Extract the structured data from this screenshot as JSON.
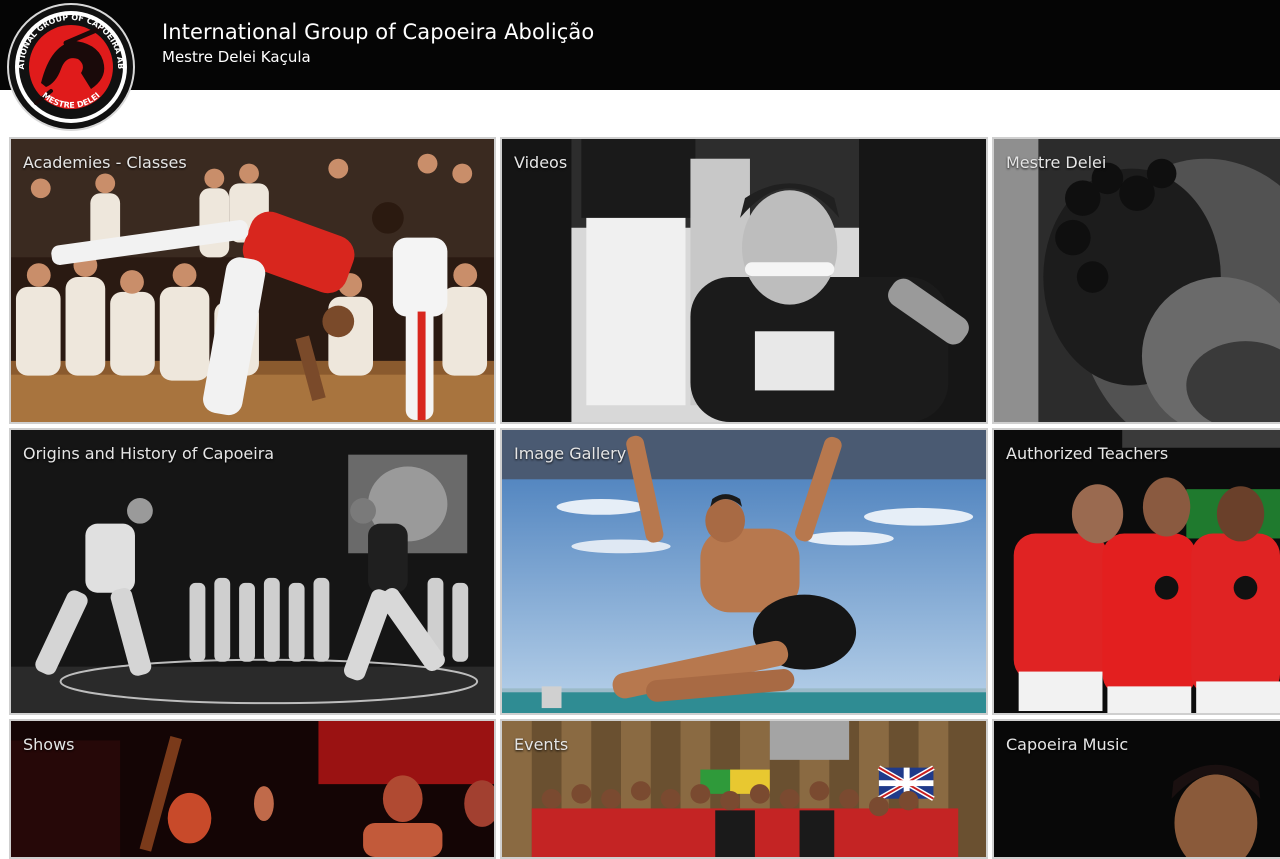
{
  "header": {
    "title": "International Group of Capoeira Abolição",
    "subtitle": "Mestre Delei Kaçula",
    "logo_top_text": "INTERNATIONAL GROUP OF CAPOEIRA ABOLIÇÃO",
    "logo_bottom_text": "MESTRE DELEI",
    "logo_color": "#e01b1b"
  },
  "tiles": [
    {
      "label": "Academies - Classes"
    },
    {
      "label": "Videos"
    },
    {
      "label": "Mestre Delei"
    },
    {
      "label": "Origins and History of Capoeira"
    },
    {
      "label": "Image Gallery"
    },
    {
      "label": "Authorized Teachers"
    },
    {
      "label": "Shows"
    },
    {
      "label": "Events"
    },
    {
      "label": "Capoeira Music"
    }
  ],
  "colors": {
    "header_bg": "#050505",
    "page_bg": "#ffffff",
    "tile_border": "#cfcfcf",
    "accent_red": "#d81e1e"
  }
}
